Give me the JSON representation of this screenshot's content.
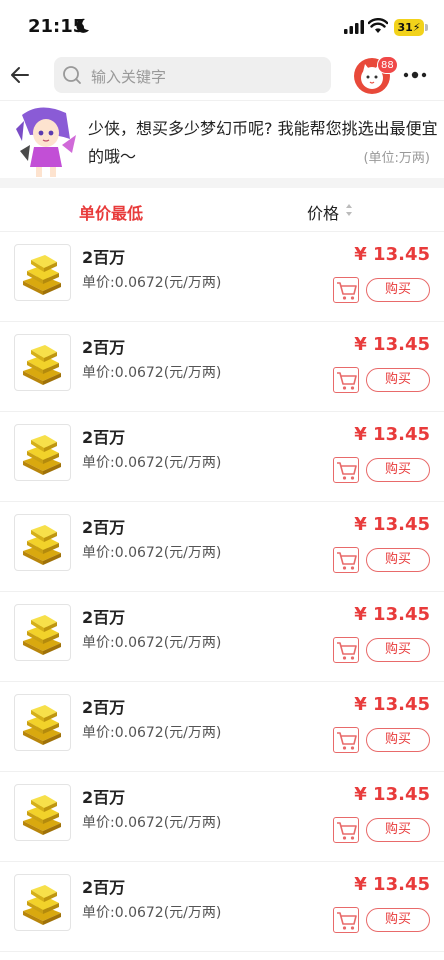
{
  "status": {
    "time": "21:15",
    "battery": "31"
  },
  "nav": {
    "search_placeholder": "输入关键字",
    "message_badge": "88"
  },
  "notice": {
    "text": "少侠，想买多少梦幻币呢? 我能帮您挑选出最便宜的哦～",
    "unit": "(单位:万两)"
  },
  "sort": {
    "unit_price_label": "单价最低",
    "price_label": "价格"
  },
  "colors": {
    "accent": "#e83b3b",
    "gold": "#e8c21a"
  },
  "items": [
    {
      "title": "2百万",
      "unit_price": "单价:0.0672(元/万两)",
      "price": "¥ 13.45",
      "buy": "购买"
    },
    {
      "title": "2百万",
      "unit_price": "单价:0.0672(元/万两)",
      "price": "¥ 13.45",
      "buy": "购买"
    },
    {
      "title": "2百万",
      "unit_price": "单价:0.0672(元/万两)",
      "price": "¥ 13.45",
      "buy": "购买"
    },
    {
      "title": "2百万",
      "unit_price": "单价:0.0672(元/万两)",
      "price": "¥ 13.45",
      "buy": "购买"
    },
    {
      "title": "2百万",
      "unit_price": "单价:0.0672(元/万两)",
      "price": "¥ 13.45",
      "buy": "购买"
    },
    {
      "title": "2百万",
      "unit_price": "单价:0.0672(元/万两)",
      "price": "¥ 13.45",
      "buy": "购买"
    },
    {
      "title": "2百万",
      "unit_price": "单价:0.0672(元/万两)",
      "price": "¥ 13.45",
      "buy": "购买"
    },
    {
      "title": "2百万",
      "unit_price": "单价:0.0672(元/万两)",
      "price": "¥ 13.45",
      "buy": "购买"
    }
  ]
}
